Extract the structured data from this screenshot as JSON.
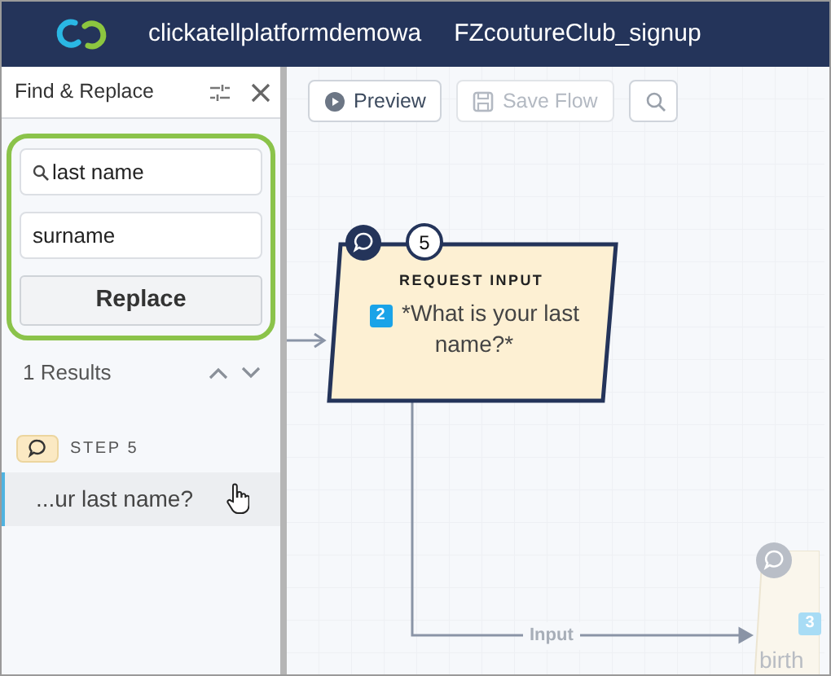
{
  "header": {
    "account": "clickatellplatformdemowa",
    "flow": "FZcoutureClub_signup"
  },
  "find_replace": {
    "title": "Find & Replace",
    "find_value": "last name",
    "replace_value": "surname",
    "replace_button": "Replace",
    "results_count": "1 Results",
    "results": [
      {
        "step": "STEP 5",
        "text": "...ur last name?",
        "selected": true
      }
    ]
  },
  "toolbar": [
    {
      "label": "Preview",
      "kind": "preview",
      "disabled": false
    },
    {
      "label": "Save Flow",
      "kind": "save",
      "disabled": true
    },
    {
      "kind": "search",
      "disabled": false
    }
  ],
  "nodes": [
    {
      "number": "5",
      "type": "REQUEST INPUT",
      "index": "2",
      "text": "*What is your last name?*",
      "kind": "active"
    },
    {
      "index": "3",
      "text": "birth",
      "kind": "faded"
    }
  ],
  "edge_label": "Input"
}
